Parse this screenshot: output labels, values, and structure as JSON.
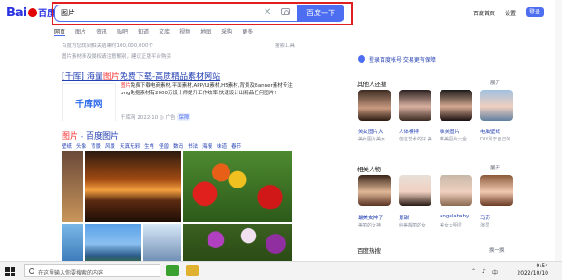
{
  "logo": {
    "left": "Bai",
    "right": "百度"
  },
  "search": {
    "value": "图片",
    "button_label": "百度一下",
    "clear_symbol": "✕"
  },
  "header_links": {
    "home": "百度首页",
    "settings": "设置",
    "login": "登录"
  },
  "tabs": [
    "网页",
    "图片",
    "资讯",
    "贴吧",
    "知道",
    "文库",
    "视频",
    "地图",
    "采购",
    "更多"
  ],
  "stats": {
    "result_count": "百度为您找到相关结果约100,000,000个",
    "tools": "搜索工具"
  },
  "notice": "图片素材涉及侵权请注意甄别，建议正版平台购买",
  "result1": {
    "title_before": "[千库] 海量",
    "title_em": "图片",
    "title_after": "免费下载-高质精品素材网站",
    "thumb_text": "千库网",
    "snippet_em": "图片",
    "snippet": "免费下载电商素材,平面素材,APP/UI素材,H5素材,背景及Banner素材专注png免抠素材有2000万设计师提升工作效率,快速设计出精品任何图片!",
    "meta_site": "千库网",
    "meta_date": "2022-10",
    "meta_ad": "广告",
    "meta_badge": "保障"
  },
  "result2": {
    "title_em": "图片",
    "title_after": " - 百度图片",
    "subnav": [
      "壁纸",
      "头像",
      "背景",
      "风景",
      "天真无邪",
      "生肖",
      "怪兽",
      "数码",
      "书法",
      "海报",
      "味道",
      "春节"
    ]
  },
  "right": {
    "login_tip": "登录百度帐号 交易更有保障",
    "section1_title": "其他人还搜",
    "section1_more": "展开",
    "people1": [
      {
        "name": "美女图片大",
        "sub": "美女图片美女"
      },
      {
        "name": "人体模特",
        "sub": "但这艺术的好 美"
      },
      {
        "name": "唯美图片",
        "sub": "唯美图片大全"
      },
      {
        "name": "电脑壁纸",
        "sub": "DIY属于自己的"
      }
    ],
    "section2_title": "相关人物",
    "section2_more": "展开",
    "people2": [
      {
        "name": "最美女神子",
        "sub": "美丽的女神"
      },
      {
        "name": "景甜",
        "sub": "纯美靓丽的女"
      },
      {
        "name": "angelababy",
        "sub": "美女大明星"
      },
      {
        "name": "马苏",
        "sub": "演员"
      }
    ],
    "hot_title": "百度热搜",
    "hot_change": "换一换"
  },
  "taskbar": {
    "search_placeholder": "在这里输入你要搜索的内容",
    "time": "9:54",
    "date": "2022/10/10",
    "tray_lang": "中"
  }
}
